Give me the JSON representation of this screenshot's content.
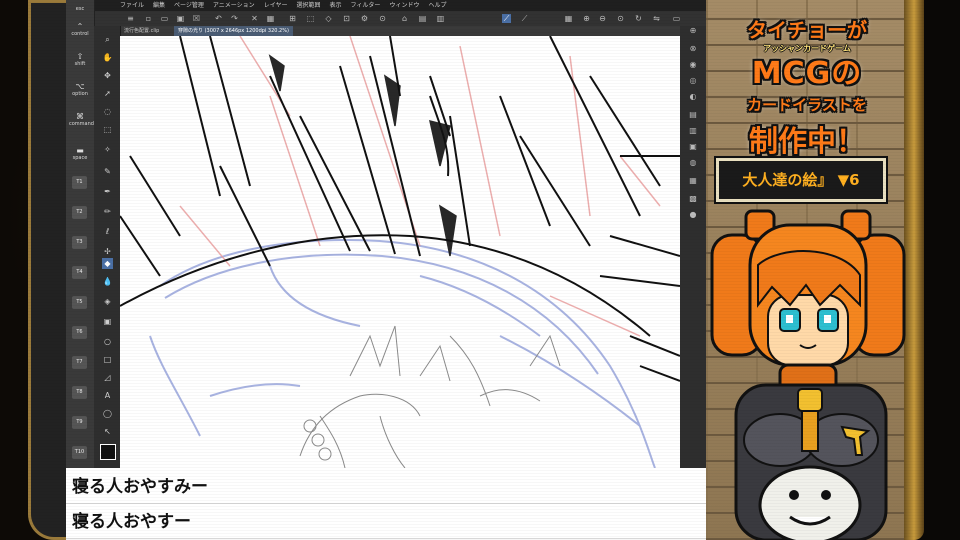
{
  "menu": {
    "items": [
      "ファイル",
      "編集",
      "ページ管理",
      "アニメーション",
      "レイヤー",
      "選択範囲",
      "表示",
      "フィルター",
      "ウィンドウ",
      "ヘルプ"
    ]
  },
  "tabs": [
    {
      "label": "流行色配置.clip"
    },
    {
      "label": "穿隙の光り (3007 x 2646px 1200dpi 320.2%)"
    }
  ],
  "keypad": {
    "esc": "esc",
    "control": "control",
    "shift": "shift",
    "option": "option",
    "command": "command",
    "space": "space",
    "tkeys": [
      "T1",
      "T2",
      "T3",
      "T4",
      "T5",
      "T6",
      "T7",
      "T8",
      "T9",
      "T10"
    ]
  },
  "comments": [
    {
      "text": "寝る人おやすみー"
    },
    {
      "text": "寝る人おやすー"
    }
  ],
  "stream": {
    "title_line1": "タイチョーが",
    "title_small": "アッシャンカードゲーム",
    "title_line2": "MCGの",
    "title_line3": "カードイラストを",
    "title_line4": "制作中！",
    "episode": "大人達の絵』 ▼6"
  },
  "colors": {
    "accent_orange": "#ff7a18",
    "frame_gold": "#c79a3c",
    "selected_tool": "#4a6fa5"
  },
  "icons": {
    "keypad": [
      "arrow-up-icon",
      "option-icon",
      "command-icon"
    ],
    "tools": [
      "zoom-icon",
      "hand-icon",
      "move-icon",
      "lasso-icon",
      "select-icon",
      "eyedropper-icon",
      "pen-icon",
      "brush-icon",
      "airbrush-icon",
      "decoration-icon",
      "eraser-icon",
      "blend-icon",
      "fill-icon",
      "gradient-icon",
      "figure-icon",
      "frame-icon",
      "text-icon",
      "balloon-icon",
      "ruler-icon",
      "color-icon"
    ]
  }
}
